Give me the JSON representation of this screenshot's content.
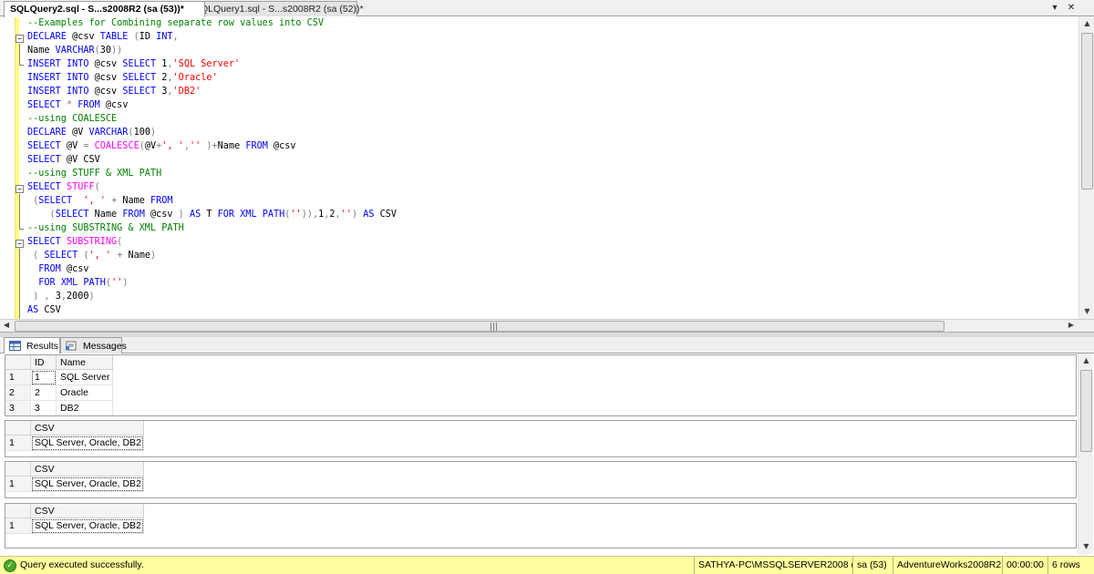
{
  "tabs": [
    {
      "label": "SQLQuery2.sql - S...s2008R2 (sa (53))*"
    },
    {
      "label": "SQLQuery1.sql - S...s2008R2 (sa (52))*"
    }
  ],
  "tab_controls": {
    "dropdown": "▾",
    "close": "✕"
  },
  "editor": {
    "lines": [
      [
        {
          "t": "--Examples for Combining separate row values into CSV",
          "c": "cm"
        }
      ],
      [
        {
          "t": "DECLARE",
          "c": "kw"
        },
        {
          "t": " @csv ",
          "c": ""
        },
        {
          "t": "TABLE",
          "c": "kw"
        },
        {
          "t": " ",
          "c": ""
        },
        {
          "t": "(",
          "c": "op"
        },
        {
          "t": "ID ",
          "c": ""
        },
        {
          "t": "INT",
          "c": "kw"
        },
        {
          "t": ",",
          "c": "op"
        }
      ],
      [
        {
          "t": "Name ",
          "c": ""
        },
        {
          "t": "VARCHAR",
          "c": "kw"
        },
        {
          "t": "(",
          "c": "op"
        },
        {
          "t": "30",
          "c": ""
        },
        {
          "t": "))",
          "c": "op"
        }
      ],
      [
        {
          "t": "INSERT",
          "c": "kw"
        },
        {
          "t": " ",
          "c": ""
        },
        {
          "t": "INTO",
          "c": "kw"
        },
        {
          "t": " @csv ",
          "c": ""
        },
        {
          "t": "SELECT",
          "c": "kw"
        },
        {
          "t": " 1",
          "c": ""
        },
        {
          "t": ",",
          "c": "op"
        },
        {
          "t": "'SQL Server'",
          "c": "str"
        }
      ],
      [
        {
          "t": "INSERT",
          "c": "kw"
        },
        {
          "t": " ",
          "c": ""
        },
        {
          "t": "INTO",
          "c": "kw"
        },
        {
          "t": " @csv ",
          "c": ""
        },
        {
          "t": "SELECT",
          "c": "kw"
        },
        {
          "t": " 2",
          "c": ""
        },
        {
          "t": ",",
          "c": "op"
        },
        {
          "t": "'Oracle'",
          "c": "str"
        }
      ],
      [
        {
          "t": "INSERT",
          "c": "kw"
        },
        {
          "t": " ",
          "c": ""
        },
        {
          "t": "INTO",
          "c": "kw"
        },
        {
          "t": " @csv ",
          "c": ""
        },
        {
          "t": "SELECT",
          "c": "kw"
        },
        {
          "t": " 3",
          "c": ""
        },
        {
          "t": ",",
          "c": "op"
        },
        {
          "t": "'DB2'",
          "c": "str"
        }
      ],
      [
        {
          "t": "SELECT",
          "c": "kw"
        },
        {
          "t": " ",
          "c": ""
        },
        {
          "t": "*",
          "c": "op"
        },
        {
          "t": " ",
          "c": ""
        },
        {
          "t": "FROM",
          "c": "kw"
        },
        {
          "t": " @csv",
          "c": ""
        }
      ],
      [
        {
          "t": "--using COALESCE",
          "c": "cm"
        }
      ],
      [
        {
          "t": "DECLARE",
          "c": "kw"
        },
        {
          "t": " @V ",
          "c": ""
        },
        {
          "t": "VARCHAR",
          "c": "kw"
        },
        {
          "t": "(",
          "c": "op"
        },
        {
          "t": "100",
          "c": ""
        },
        {
          "t": ")",
          "c": "op"
        }
      ],
      [
        {
          "t": "SELECT",
          "c": "kw"
        },
        {
          "t": " @V ",
          "c": ""
        },
        {
          "t": "=",
          "c": "op"
        },
        {
          "t": " ",
          "c": ""
        },
        {
          "t": "COALESCE",
          "c": "fn"
        },
        {
          "t": "(",
          "c": "op"
        },
        {
          "t": "@V",
          "c": ""
        },
        {
          "t": "+",
          "c": "op"
        },
        {
          "t": "', '",
          "c": "str"
        },
        {
          "t": ",",
          "c": "op"
        },
        {
          "t": "''",
          "c": "str"
        },
        {
          "t": " )",
          "c": "op"
        },
        {
          "t": "+",
          "c": "op"
        },
        {
          "t": "Name ",
          "c": ""
        },
        {
          "t": "FROM",
          "c": "kw"
        },
        {
          "t": " @csv",
          "c": ""
        }
      ],
      [
        {
          "t": "SELECT",
          "c": "kw"
        },
        {
          "t": " @V CSV",
          "c": ""
        }
      ],
      [
        {
          "t": "--using STUFF & XML PATH",
          "c": "cm"
        }
      ],
      [
        {
          "t": "SELECT",
          "c": "kw"
        },
        {
          "t": " ",
          "c": ""
        },
        {
          "t": "STUFF",
          "c": "fn"
        },
        {
          "t": "(",
          "c": "op"
        }
      ],
      [
        {
          "t": " ",
          "c": ""
        },
        {
          "t": "(",
          "c": "op"
        },
        {
          "t": "SELECT",
          "c": "kw"
        },
        {
          "t": "  ",
          "c": ""
        },
        {
          "t": "', '",
          "c": "str"
        },
        {
          "t": " ",
          "c": ""
        },
        {
          "t": "+",
          "c": "op"
        },
        {
          "t": " Name ",
          "c": ""
        },
        {
          "t": "FROM",
          "c": "kw"
        }
      ],
      [
        {
          "t": "    ",
          "c": ""
        },
        {
          "t": "(",
          "c": "op"
        },
        {
          "t": "SELECT",
          "c": "kw"
        },
        {
          "t": " Name ",
          "c": ""
        },
        {
          "t": "FROM",
          "c": "kw"
        },
        {
          "t": " @csv ",
          "c": ""
        },
        {
          "t": ")",
          "c": "op"
        },
        {
          "t": " ",
          "c": ""
        },
        {
          "t": "AS",
          "c": "kw"
        },
        {
          "t": " T ",
          "c": ""
        },
        {
          "t": "FOR",
          "c": "kw"
        },
        {
          "t": " ",
          "c": ""
        },
        {
          "t": "XML",
          "c": "kw"
        },
        {
          "t": " ",
          "c": ""
        },
        {
          "t": "PATH",
          "c": "kw"
        },
        {
          "t": "(",
          "c": "op"
        },
        {
          "t": "''",
          "c": "str"
        },
        {
          "t": ")),",
          "c": "op"
        },
        {
          "t": "1",
          "c": ""
        },
        {
          "t": ",",
          "c": "op"
        },
        {
          "t": "2",
          "c": ""
        },
        {
          "t": ",",
          "c": "op"
        },
        {
          "t": "''",
          "c": "str"
        },
        {
          "t": ")",
          "c": "op"
        },
        {
          "t": " ",
          "c": ""
        },
        {
          "t": "AS",
          "c": "kw"
        },
        {
          "t": " CSV",
          "c": ""
        }
      ],
      [
        {
          "t": "--using SUBSTRING & XML PATH",
          "c": "cm"
        }
      ],
      [
        {
          "t": "SELECT",
          "c": "kw"
        },
        {
          "t": " ",
          "c": ""
        },
        {
          "t": "SUBSTRING",
          "c": "fn"
        },
        {
          "t": "(",
          "c": "op"
        }
      ],
      [
        {
          "t": " ",
          "c": ""
        },
        {
          "t": "(",
          "c": "op"
        },
        {
          "t": " ",
          "c": ""
        },
        {
          "t": "SELECT",
          "c": "kw"
        },
        {
          "t": " ",
          "c": ""
        },
        {
          "t": "(",
          "c": "op"
        },
        {
          "t": "', '",
          "c": "str"
        },
        {
          "t": " ",
          "c": ""
        },
        {
          "t": "+",
          "c": "op"
        },
        {
          "t": " Name",
          "c": ""
        },
        {
          "t": ")",
          "c": "op"
        }
      ],
      [
        {
          "t": "  ",
          "c": ""
        },
        {
          "t": "FROM",
          "c": "kw"
        },
        {
          "t": " @csv",
          "c": ""
        }
      ],
      [
        {
          "t": "  ",
          "c": ""
        },
        {
          "t": "FOR",
          "c": "kw"
        },
        {
          "t": " ",
          "c": ""
        },
        {
          "t": "XML",
          "c": "kw"
        },
        {
          "t": " ",
          "c": ""
        },
        {
          "t": "PATH",
          "c": "kw"
        },
        {
          "t": "(",
          "c": "op"
        },
        {
          "t": "''",
          "c": "str"
        },
        {
          "t": ")",
          "c": "op"
        }
      ],
      [
        {
          "t": " ",
          "c": ""
        },
        {
          "t": ")",
          "c": "op"
        },
        {
          "t": " ",
          "c": ""
        },
        {
          "t": ",",
          "c": "op"
        },
        {
          "t": " 3",
          "c": ""
        },
        {
          "t": ",",
          "c": "op"
        },
        {
          "t": "2000",
          "c": ""
        },
        {
          "t": ")",
          "c": "op"
        }
      ],
      [
        {
          "t": "AS",
          "c": "kw"
        },
        {
          "t": " CSV",
          "c": ""
        }
      ]
    ]
  },
  "results_tabs": {
    "results": "Results",
    "messages": "Messages"
  },
  "grid1": {
    "headers": [
      "ID",
      "Name"
    ],
    "rows": [
      {
        "num": "1",
        "id": "1",
        "name": "SQL Server"
      },
      {
        "num": "2",
        "id": "2",
        "name": "Oracle"
      },
      {
        "num": "3",
        "id": "3",
        "name": "DB2"
      }
    ]
  },
  "csv_grids": [
    {
      "header": "CSV",
      "num": "1",
      "value": "SQL Server, Oracle, DB2"
    },
    {
      "header": "CSV",
      "num": "1",
      "value": "SQL Server, Oracle, DB2"
    },
    {
      "header": "CSV",
      "num": "1",
      "value": "SQL Server, Oracle, DB2"
    }
  ],
  "status": {
    "message": "Query executed successfully.",
    "server": "SATHYA-PC\\MSSQLSERVER2008 (...",
    "user": "sa (53)",
    "database": "AdventureWorks2008R2",
    "elapsed": "00:00:00",
    "rows": "6 rows"
  }
}
